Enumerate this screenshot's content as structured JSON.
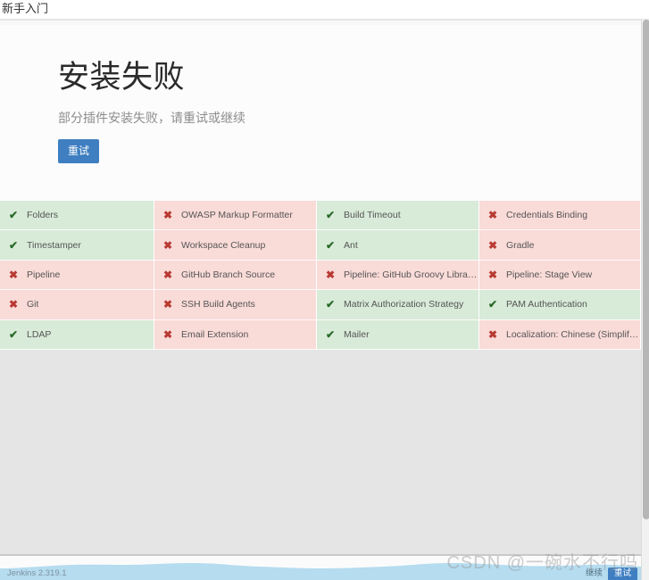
{
  "header": {
    "tab_label": "新手入门"
  },
  "hero": {
    "title": "安装失败",
    "subtitle": "部分插件安装失败，请重试或继续",
    "retry_label": "重试"
  },
  "grid": {
    "icons": {
      "success": "✔",
      "fail": "✖"
    },
    "columns": [
      [
        {
          "name": "Folders",
          "status": "success"
        },
        {
          "name": "Timestamper",
          "status": "success"
        },
        {
          "name": "Pipeline",
          "status": "fail"
        },
        {
          "name": "Git",
          "status": "fail"
        },
        {
          "name": "LDAP",
          "status": "success"
        }
      ],
      [
        {
          "name": "OWASP Markup Formatter",
          "status": "fail"
        },
        {
          "name": "Workspace Cleanup",
          "status": "fail"
        },
        {
          "name": "GitHub Branch Source",
          "status": "fail"
        },
        {
          "name": "SSH Build Agents",
          "status": "fail"
        },
        {
          "name": "Email Extension",
          "status": "fail"
        }
      ],
      [
        {
          "name": "Build Timeout",
          "status": "success"
        },
        {
          "name": "Ant",
          "status": "success"
        },
        {
          "name": "Pipeline: GitHub Groovy Libraries",
          "status": "fail"
        },
        {
          "name": "Matrix Authorization Strategy",
          "status": "success"
        },
        {
          "name": "Mailer",
          "status": "success"
        }
      ],
      [
        {
          "name": "Credentials Binding",
          "status": "fail"
        },
        {
          "name": "Gradle",
          "status": "fail"
        },
        {
          "name": "Pipeline: Stage View",
          "status": "fail"
        },
        {
          "name": "PAM Authentication",
          "status": "success"
        },
        {
          "name": "Localization: Chinese (Simplified)",
          "status": "fail"
        }
      ]
    ]
  },
  "footer": {
    "version": "Jenkins 2.319.1",
    "continue_label": "继续",
    "retry_label": "重试"
  },
  "watermark": {
    "text": "CSDN @一碗水不行吗"
  },
  "colors": {
    "accent_blue": "#3f7fc1",
    "success_bg": "#d8ead8",
    "fail_bg": "#f9dbd8",
    "success_icon": "#2a6b2a",
    "fail_icon": "#b83a32",
    "page_bg": "#e5e5e5",
    "wave_blue": "#b5dcef"
  }
}
